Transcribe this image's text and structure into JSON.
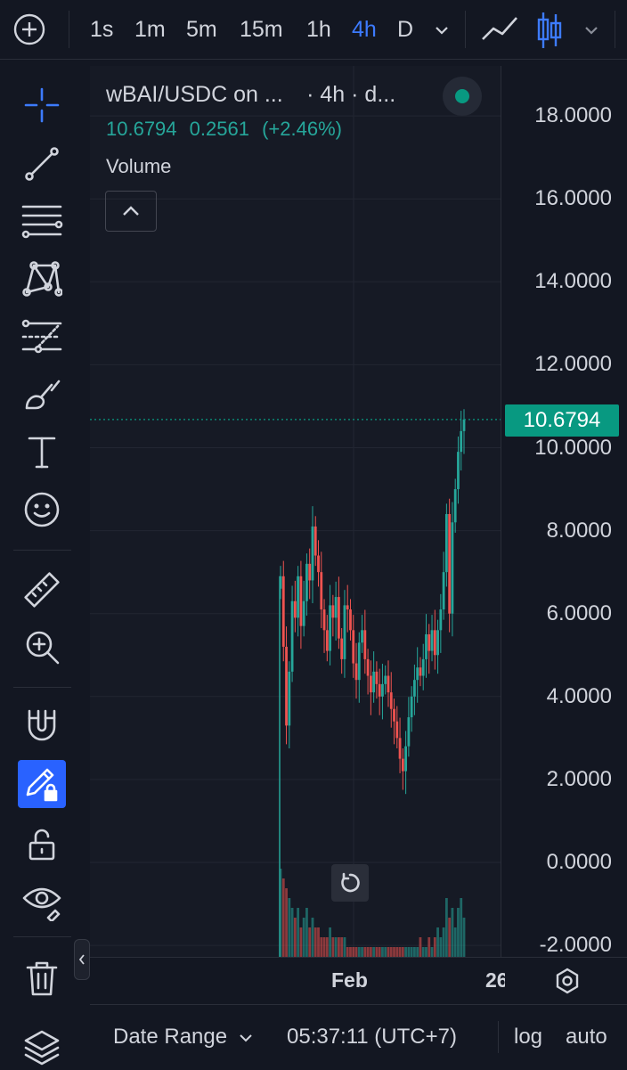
{
  "toolbar": {
    "add_icon": "plus-circle-icon",
    "intervals": [
      "1s",
      "1m",
      "5m",
      "15m",
      "1h",
      "4h",
      "D"
    ],
    "active_interval": "4h",
    "colors": {
      "active": "#3d7bff",
      "up": "#26a69a",
      "down": "#ef5350",
      "accent": "#089981"
    }
  },
  "left_tools": [
    "crosshair-icon",
    "trend-line-icon",
    "horizontal-lines-icon",
    "pattern-icon",
    "fib-retracement-icon",
    "brush-icon",
    "text-icon",
    "emoji-icon",
    "ruler-icon",
    "zoom-in-icon",
    "magnet-icon",
    "lock-drawing-icon",
    "unlock-icon",
    "eye-icon",
    "trash-icon",
    "layers-icon"
  ],
  "legend": {
    "symbol": "wBAI/USDC on ...",
    "interval_suffix": "· 4h · d...",
    "last": "10.6794",
    "change": "0.2561",
    "change_pct": "(+2.46%)",
    "volume_label": "Volume"
  },
  "price_scale": {
    "labels": [
      "18.0000",
      "16.0000",
      "14.0000",
      "12.0000",
      "10.0000",
      "8.0000",
      "6.0000",
      "4.0000",
      "2.0000",
      "0.0000",
      "-2.0000"
    ],
    "current": "10.6794"
  },
  "time_axis": {
    "labels": [
      "Feb",
      "26"
    ]
  },
  "bottom": {
    "date_range": "Date Range",
    "time": "05:37:11 (UTC+7)",
    "log": "log",
    "auto": "auto"
  },
  "chart_data": {
    "type": "candlestick",
    "interval": "4h",
    "ylim": [
      -2,
      18
    ],
    "close": [
      6.9,
      5.2,
      3.3,
      4.6,
      6.3,
      5.9,
      6.9,
      5.7,
      6.3,
      7.2,
      6.8,
      8.1,
      7.4,
      7.0,
      6.1,
      5.6,
      5.1,
      6.2,
      5.9,
      6.4,
      5.4,
      4.9,
      6.2,
      6.1,
      5.6,
      4.8,
      4.4,
      5.3,
      5.6,
      4.9,
      4.5,
      4.1,
      4.6,
      4.3,
      4.0,
      4.3,
      4.5,
      4.1,
      3.7,
      3.4,
      3.0,
      2.5,
      2.2,
      2.8,
      3.5,
      4.0,
      4.4,
      4.7,
      4.5,
      4.9,
      5.5,
      5.1,
      5.6,
      5.0,
      5.6,
      6.1,
      7.0,
      8.4,
      6.0,
      8.2,
      9.0,
      9.9,
      10.4,
      10.6794
    ],
    "volume_relative": [
      0.9,
      0.8,
      0.7,
      0.6,
      0.5,
      0.4,
      0.5,
      0.3,
      0.4,
      0.5,
      0.3,
      0.4,
      0.3,
      0.3,
      0.2,
      0.2,
      0.2,
      0.3,
      0.2,
      0.2,
      0.2,
      0.2,
      0.2,
      0.1,
      0.1,
      0.1,
      0.1,
      0.1,
      0.1,
      0.1,
      0.1,
      0.1,
      0.1,
      0.1,
      0.1,
      0.1,
      0.1,
      0.1,
      0.1,
      0.1,
      0.1,
      0.1,
      0.1,
      0.1,
      0.1,
      0.1,
      0.1,
      0.1,
      0.2,
      0.1,
      0.1,
      0.2,
      0.1,
      0.2,
      0.3,
      0.2,
      0.3,
      0.6,
      0.4,
      0.5,
      0.3,
      0.5,
      0.6,
      0.4
    ]
  }
}
